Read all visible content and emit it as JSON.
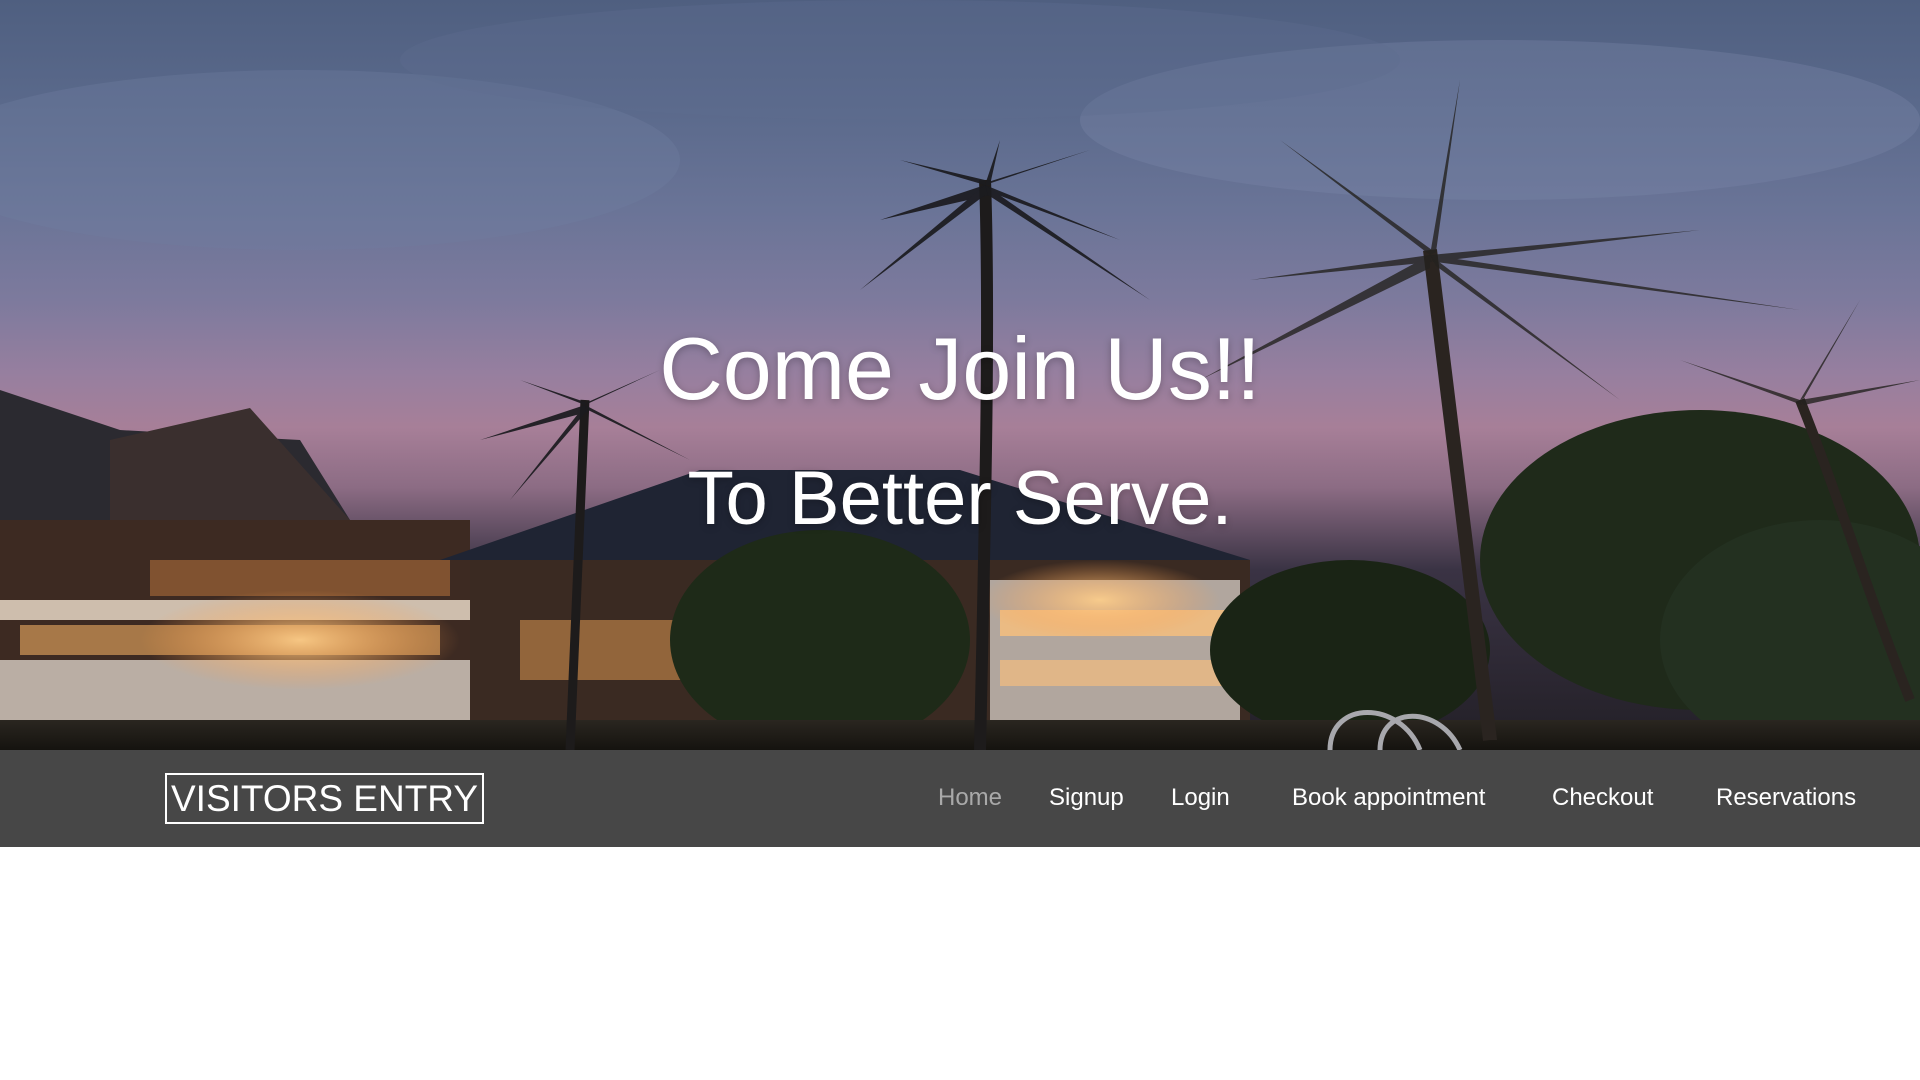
{
  "hero": {
    "title": "Come Join Us!!",
    "subtitle": "To Better Serve."
  },
  "navbar": {
    "brand": "VISITORS ENTRY",
    "links": [
      {
        "label": "Home",
        "active": true
      },
      {
        "label": "Signup",
        "active": false
      },
      {
        "label": "Login",
        "active": false
      },
      {
        "label": "Book appointment",
        "active": false
      },
      {
        "label": "Checkout",
        "active": false
      },
      {
        "label": "Reservations",
        "active": false
      }
    ]
  },
  "colors": {
    "navbar_bg": "#474747",
    "nav_text": "#ffffff",
    "nav_active_text": "#a9a9a9",
    "hero_text": "#ffffff"
  }
}
